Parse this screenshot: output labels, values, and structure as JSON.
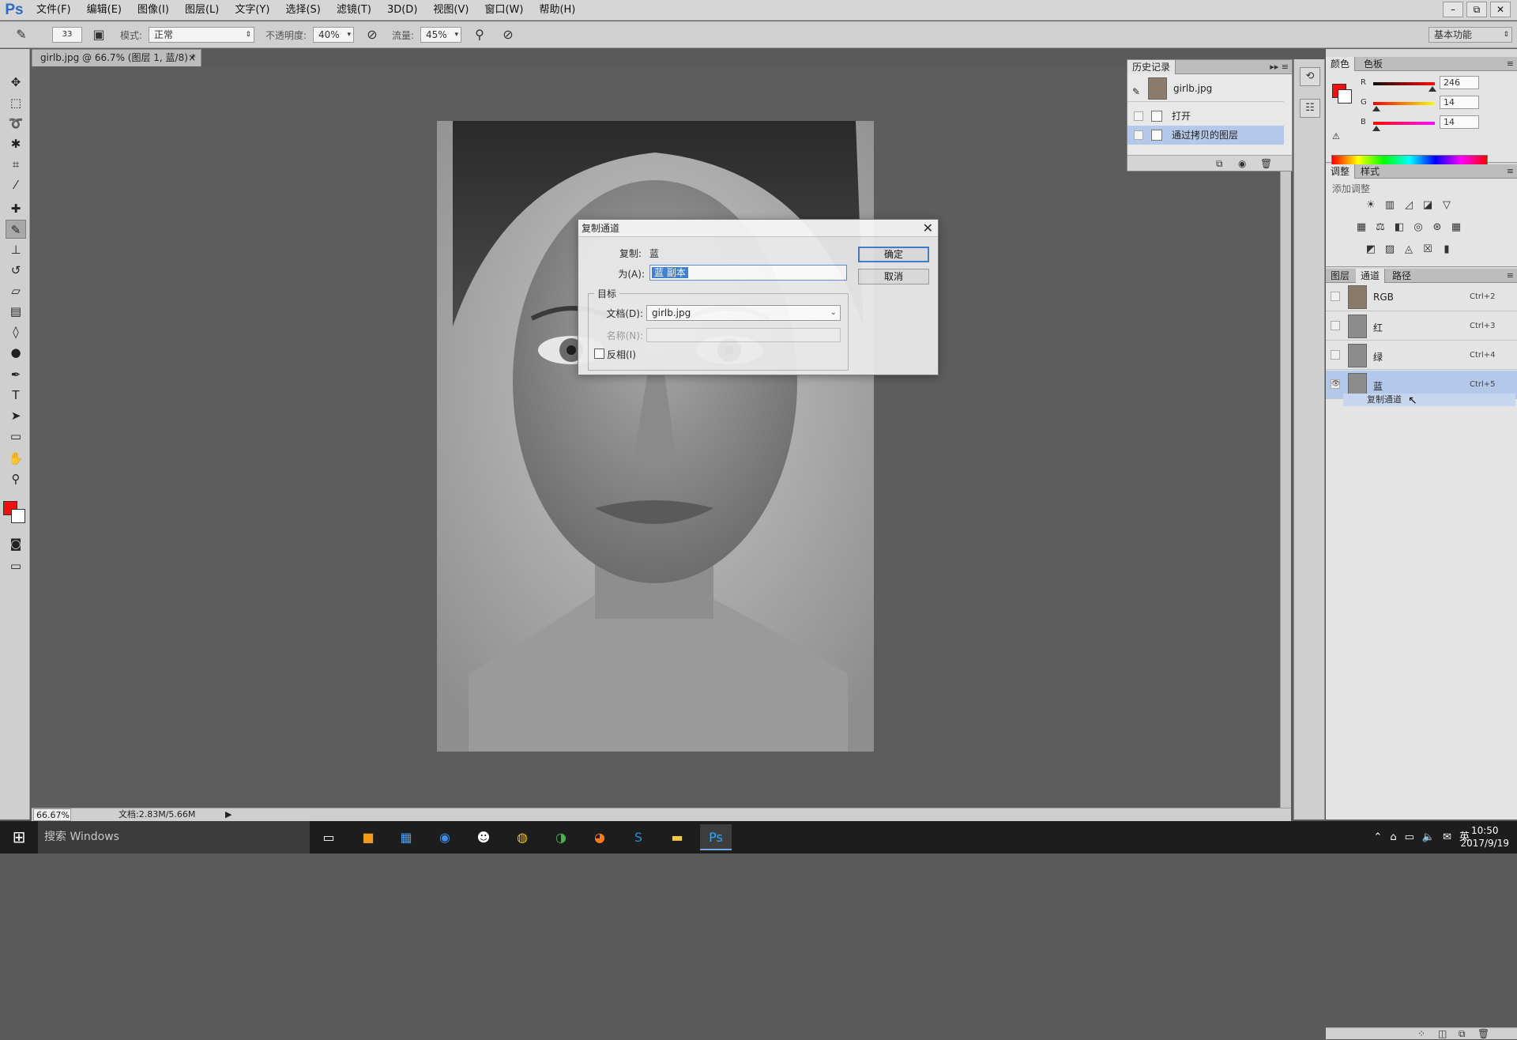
{
  "app": {
    "logo": "Ps"
  },
  "menu": [
    "文件(F)",
    "编辑(E)",
    "图像(I)",
    "图层(L)",
    "文字(Y)",
    "选择(S)",
    "滤镜(T)",
    "3D(D)",
    "视图(V)",
    "窗口(W)",
    "帮助(H)"
  ],
  "window_controls": [
    "–",
    "⧉",
    "✕"
  ],
  "options_bar": {
    "brush_size": "33",
    "mode_label": "模式:",
    "mode_value": "正常",
    "opacity_label": "不透明度:",
    "opacity_value": "40%",
    "flow_label": "流量:",
    "flow_value": "45%",
    "workspace": "基本功能"
  },
  "document": {
    "tab_title": "girlb.jpg @ 66.7% (图层 1, 蓝/8) *",
    "zoom": "66.67%",
    "doc_size": "文档:2.83M/5.66M"
  },
  "dialog": {
    "title": "复制通道",
    "source_label": "复制:",
    "source_value": "蓝",
    "as_label": "为(A):",
    "as_value": "蓝 副本",
    "group_label": "目标",
    "doc_label": "文档(D):",
    "doc_value": "girlb.jpg",
    "name_label": "名称(N):",
    "invert_label": "反相(I)",
    "invert_checked": false,
    "ok": "确定",
    "cancel": "取消"
  },
  "history": {
    "tab": "历史记录",
    "snapshot": "girlb.jpg",
    "items": [
      "打开",
      "通过拷贝的图层"
    ],
    "selected_index": 1
  },
  "color_panel": {
    "tabs": [
      "颜色",
      "色板"
    ],
    "fg_color": "#f60e0e",
    "r_label": "R",
    "r": "246",
    "g_label": "G",
    "g": "14",
    "b_label": "B",
    "b": "14",
    "r_level": 0.965,
    "g_level": 0.055,
    "b_level": 0.055
  },
  "adjust_panel": {
    "tabs": [
      "调整",
      "样式"
    ],
    "subtitle": "添加调整"
  },
  "channels_panel": {
    "tabs": [
      "图层",
      "通道",
      "路径"
    ],
    "channels": [
      {
        "name": "RGB",
        "shortcut": "Ctrl+2"
      },
      {
        "name": "红",
        "shortcut": "Ctrl+3"
      },
      {
        "name": "绿",
        "shortcut": "Ctrl+4"
      },
      {
        "name": "蓝",
        "shortcut": "Ctrl+5"
      }
    ],
    "selected_index": 3,
    "drag_label": "复制通道"
  },
  "taskbar": {
    "search_placeholder": "搜索 Windows",
    "time": "10:50",
    "date": "2017/9/19",
    "ime": "英"
  },
  "colors": {
    "accent": "#3c7fd5",
    "selection": "#b4c9ea",
    "foreground": "#f60e0e"
  }
}
